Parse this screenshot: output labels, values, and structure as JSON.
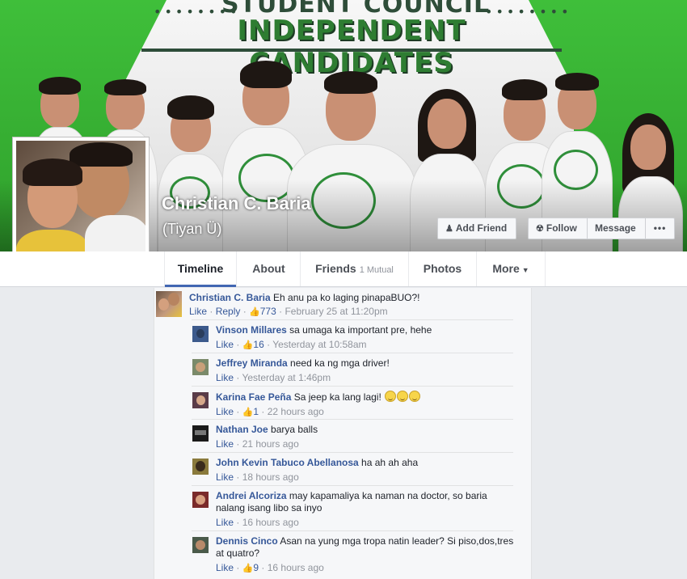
{
  "cover": {
    "line1": "STUDENT COUNCIL",
    "line2": "INDEPENDENT CANDIDATES",
    "dots_left": "••••••••",
    "dots_right": "••••••••",
    "accent_color": "#2e7d32"
  },
  "profile": {
    "name": "Christian C. Baria",
    "nickname": "(Tiyan Ü)"
  },
  "actions": {
    "add_friend": "Add Friend",
    "follow": "Follow",
    "message": "Message",
    "more": "•••"
  },
  "nav": {
    "tabs": [
      {
        "label": "Timeline"
      },
      {
        "label": "About"
      },
      {
        "label": "Friends",
        "sub": "1 Mutual"
      },
      {
        "label": "Photos"
      },
      {
        "label": "More"
      }
    ]
  },
  "post_comment": {
    "author": "Christian C. Baria",
    "text": "Eh anu pa ko laging pinapaBUO?!",
    "like": "Like",
    "reply": "Reply",
    "likes": "773",
    "time": "February 25 at 11:20pm"
  },
  "replies": [
    {
      "author": "Vinson Millares",
      "text": "sa umaga ka important pre, hehe",
      "like": "Like",
      "likes": "16",
      "time": "Yesterday at 10:58am"
    },
    {
      "author": "Jeffrey Miranda",
      "text": "need ka ng mga driver!",
      "like": "Like",
      "likes": "",
      "time": "Yesterday at 1:46pm"
    },
    {
      "author": "Karina Fae Peña",
      "text": "Sa jeep ka lang lagi!",
      "like": "Like",
      "likes": "1",
      "time": "22 hours ago"
    },
    {
      "author": "Nathan Joe",
      "text": "barya balls",
      "like": "Like",
      "likes": "",
      "time": "21 hours ago"
    },
    {
      "author": "John Kevin Tabuco Abellanosa",
      "text": "ha ah ah aha",
      "like": "Like",
      "likes": "",
      "time": "18 hours ago"
    },
    {
      "author": "Andrei Alcoriza",
      "text": "may kapamaliya ka naman na doctor, so baria nalang isang libo sa inyo",
      "like": "Like",
      "likes": "",
      "time": "16 hours ago"
    },
    {
      "author": "Dennis Cinco",
      "text": "Asan na yung mga tropa natin leader? Si piso,dos,tres at quatro?",
      "like": "Like",
      "likes": "9",
      "time": "16 hours ago"
    }
  ],
  "icons": {
    "add_friend": "person-plus-icon",
    "follow": "rss-icon",
    "like": "thumbs-up-icon",
    "more_caret": "caret-down-icon"
  },
  "colors": {
    "link": "#365899",
    "meta": "#90949c",
    "tab_active": "#4267b2"
  }
}
